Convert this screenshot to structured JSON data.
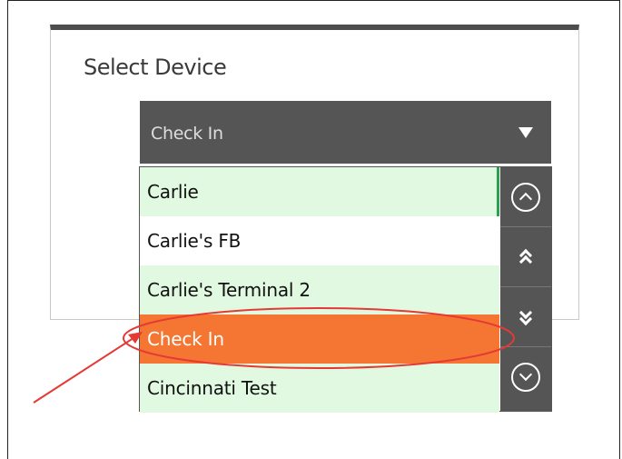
{
  "dialog": {
    "title": "Select Device"
  },
  "device_select": {
    "selected_value": "Check In",
    "options": [
      {
        "label": "Carlie"
      },
      {
        "label": "Carlie's  FB"
      },
      {
        "label": "Carlie's Terminal 2"
      },
      {
        "label": "Check In"
      },
      {
        "label": "Cincinnati Test"
      }
    ]
  },
  "scroll_controls": {
    "icons": [
      "circle-chevron-up-icon",
      "double-chevron-up-icon",
      "double-chevron-down-icon",
      "circle-chevron-down-icon"
    ]
  },
  "colors": {
    "header_bar": "#4d4d4d",
    "select_bg": "#555555",
    "option_green": "#e1f9e1",
    "option_selected": "#f47632",
    "annotation": "#e53935"
  }
}
